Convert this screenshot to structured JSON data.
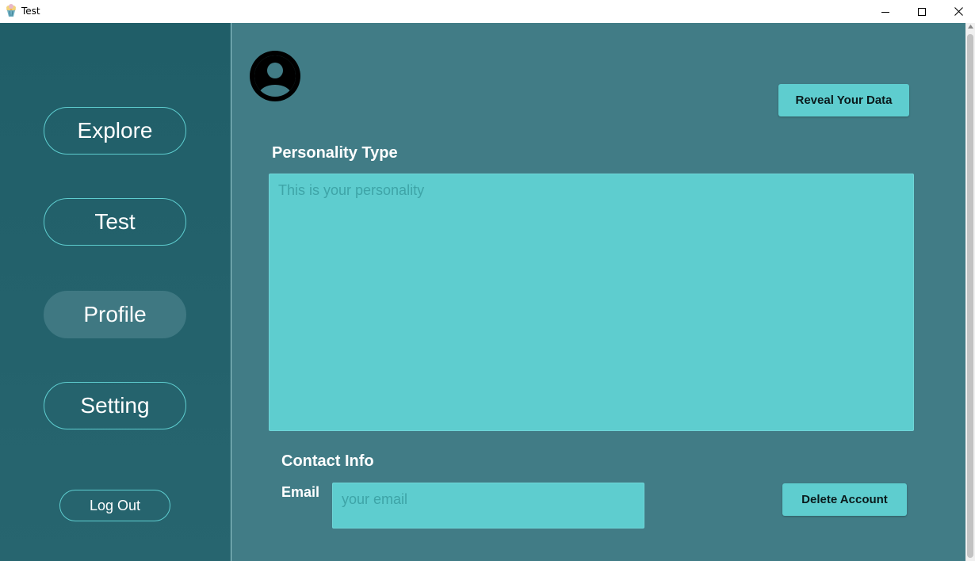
{
  "window": {
    "title": "Test",
    "app_icon": "cupcake-app-icon",
    "controls": [
      "minimize-icon",
      "maximize-icon",
      "close-icon"
    ]
  },
  "sidebar": {
    "items": [
      {
        "label": "Explore",
        "active": false
      },
      {
        "label": "Test",
        "active": false
      },
      {
        "label": "Profile",
        "active": true
      },
      {
        "label": "Setting",
        "active": false
      }
    ],
    "logout_label": "Log Out"
  },
  "main": {
    "avatar_icon": "user-avatar-icon",
    "reveal_button": "Reveal Your Data",
    "personality": {
      "title": "Personality Type",
      "placeholder": "This is your personality"
    },
    "contact": {
      "title": "Contact Info",
      "email_label": "Email",
      "email_placeholder": "your email"
    },
    "delete_button": "Delete Account"
  },
  "colors": {
    "sidebar_bg": "#205e68",
    "main_bg": "#417c86",
    "accent": "#5ecdcf",
    "active_nav": "#3f7882",
    "placeholder_text": "#3ea4a7"
  }
}
